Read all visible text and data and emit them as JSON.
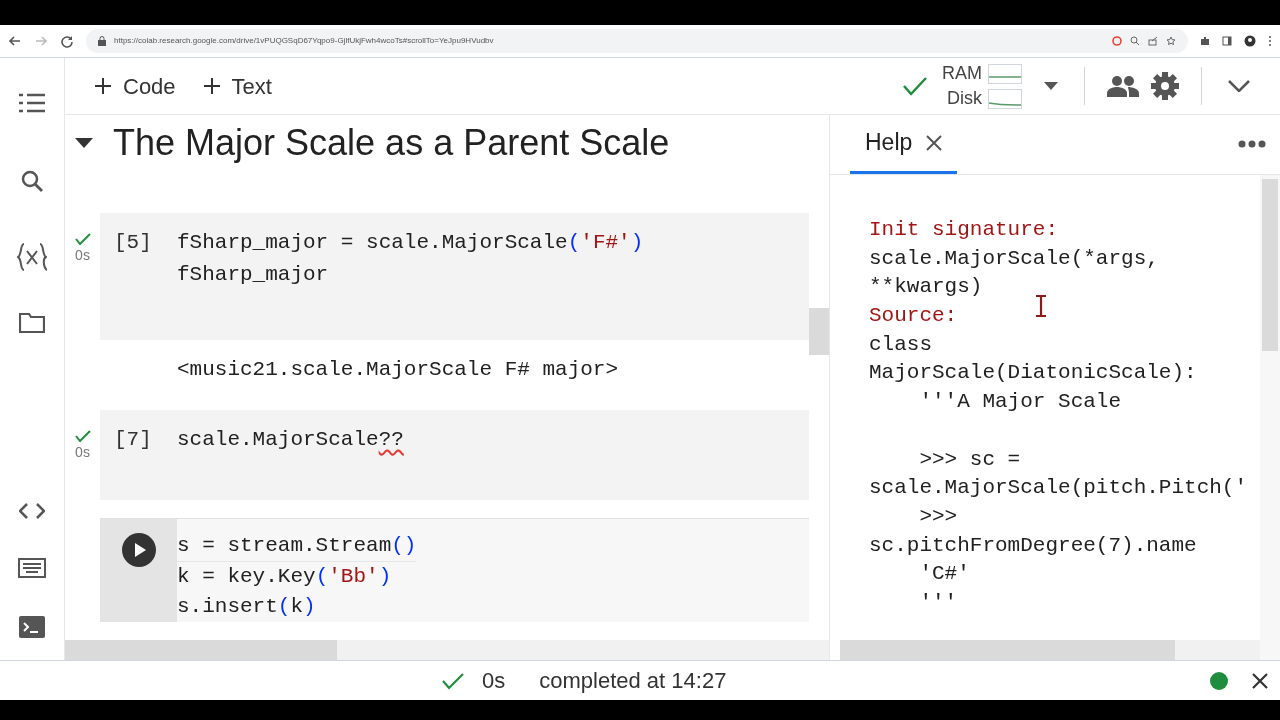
{
  "browser": {
    "url": "https://colab.research.google.com/drive/1vPUQGSqD67Yqpo9-GjlfUkjFwh4wcoTs#scrollTo=YeJpu9HVudbv"
  },
  "toolbar": {
    "add_buttons": [
      {
        "label": "Code"
      },
      {
        "label": "Text"
      }
    ],
    "connected": true,
    "meters": [
      "RAM",
      "Disk"
    ]
  },
  "section": {
    "title": "The Major Scale as a Parent Scale",
    "expanded": true
  },
  "cells": [
    {
      "count": "[5]",
      "ran": true,
      "time": "0s",
      "focused": false,
      "lines": [
        [
          {
            "kind": "plain",
            "text": "fSharp_major = scale.MajorScale"
          },
          {
            "kind": "paren",
            "text": "("
          },
          {
            "kind": "string",
            "text": "'F#'"
          },
          {
            "kind": "paren",
            "text": ")"
          }
        ],
        [
          {
            "kind": "plain",
            "text": "fSharp_major"
          }
        ]
      ],
      "output": "<music21.scale.MajorScale F# major>"
    },
    {
      "count": "[7]",
      "ran": true,
      "time": "0s",
      "focused": false,
      "lines": [
        [
          {
            "kind": "plain",
            "text": "scale.MajorScale"
          },
          {
            "kind": "error",
            "text": "??"
          }
        ]
      ]
    },
    {
      "ran": false,
      "focused": true,
      "lines": [
        [
          {
            "kind": "plain",
            "text": "s = stream.Stream"
          },
          {
            "kind": "paren",
            "text": "()"
          }
        ],
        [
          {
            "kind": "plain",
            "text": "k = key.Key"
          },
          {
            "kind": "paren",
            "text": "("
          },
          {
            "kind": "string",
            "text": "'Bb'"
          },
          {
            "kind": "paren",
            "text": ")"
          }
        ],
        [
          {
            "kind": "plain",
            "text": "s.insert"
          },
          {
            "kind": "paren",
            "text": "("
          },
          {
            "kind": "plain",
            "text": "k"
          },
          {
            "kind": "paren",
            "text": ")"
          }
        ]
      ]
    }
  ],
  "help": {
    "tab": {
      "label": "Help",
      "selected": true
    },
    "lines": [
      {
        "kind": "label",
        "text": "Init signature:"
      },
      {
        "kind": "code",
        "text": "scale.MajorScale(*args,"
      },
      {
        "kind": "code",
        "text": "**kwargs)"
      },
      {
        "kind": "label",
        "text": "Source:"
      },
      {
        "kind": "code",
        "text": "class"
      },
      {
        "kind": "code",
        "text": "MajorScale(DiatonicScale):"
      },
      {
        "kind": "code",
        "text": "    '''A Major Scale"
      },
      {
        "kind": "blank"
      },
      {
        "kind": "code",
        "text": "    >>> sc ="
      },
      {
        "kind": "code",
        "text": "scale.MajorScale(pitch.Pitch('"
      },
      {
        "kind": "code",
        "text": "    >>>"
      },
      {
        "kind": "code",
        "text": "sc.pitchFromDegree(7).name"
      },
      {
        "kind": "code",
        "text": "    'C#'"
      },
      {
        "kind": "code",
        "text": "    '''"
      }
    ]
  },
  "status": {
    "ok": true,
    "time": "0s",
    "message": "completed at 14:27",
    "connected": true
  }
}
